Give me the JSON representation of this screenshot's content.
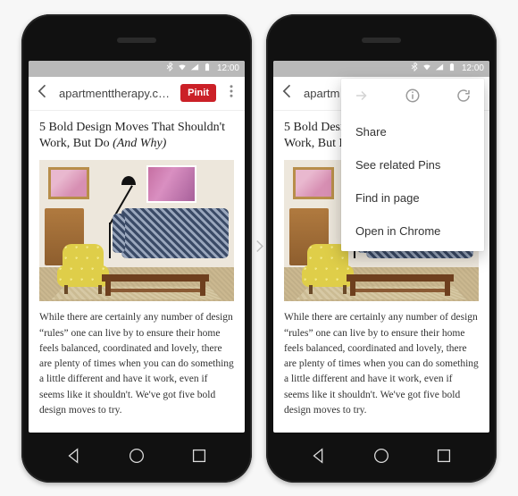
{
  "statusbar": {
    "time": "12:00"
  },
  "toolbar": {
    "domain": "apartmenttherapy.com",
    "domain_truncated": "apartm",
    "pinit_label": "Pinit"
  },
  "article": {
    "headline_main": "5 Bold Design Moves That Shouldn't Work, But Do ",
    "headline_paren": "(And Why)",
    "body": "While there are certainly any number of design “rules” one can live by to ensure their home feels balanced, coordinated and lovely, there are plenty of times when you can do something a little different and have it work, even if seems like it shouldn't. We've got five bold design moves to try."
  },
  "menu": {
    "items": [
      {
        "label": "Share"
      },
      {
        "label": "See related Pins"
      },
      {
        "label": "Find in page"
      },
      {
        "label": "Open in Chrome"
      }
    ]
  }
}
